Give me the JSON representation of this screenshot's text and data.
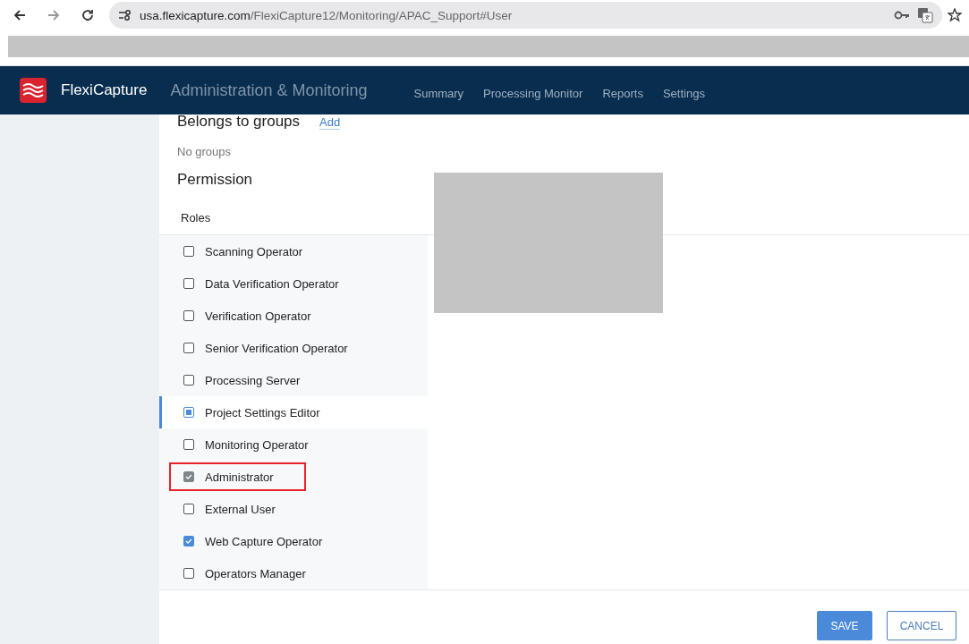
{
  "browser": {
    "url_host": "usa.flexicapture.com",
    "url_path": "/FlexiCapture12/Monitoring/APAC_Support#User"
  },
  "app_header": {
    "brand": "FlexiCapture",
    "section": "Administration & Monitoring",
    "nav": [
      {
        "label": "Summary",
        "selected": false
      },
      {
        "label": "Processing Monitor",
        "selected": false
      },
      {
        "label": "Reports",
        "selected": false
      },
      {
        "label": "Settings",
        "selected": false
      }
    ]
  },
  "groups": {
    "title": "Belongs to groups",
    "add_link": "Add",
    "empty_text": "No groups"
  },
  "permission": {
    "title": "Permission",
    "roles_header": "Roles",
    "roles": [
      {
        "label": "Scanning Operator",
        "kind": "checkbox",
        "checked": false,
        "disabled": false,
        "selected": false,
        "highlighted": false
      },
      {
        "label": "Data Verification Operator",
        "kind": "checkbox",
        "checked": false,
        "disabled": false,
        "selected": false,
        "highlighted": false
      },
      {
        "label": "Verification Operator",
        "kind": "checkbox",
        "checked": false,
        "disabled": false,
        "selected": false,
        "highlighted": false
      },
      {
        "label": "Senior Verification Operator",
        "kind": "checkbox",
        "checked": false,
        "disabled": false,
        "selected": false,
        "highlighted": false
      },
      {
        "label": "Processing Server",
        "kind": "checkbox",
        "checked": false,
        "disabled": false,
        "selected": false,
        "highlighted": false
      },
      {
        "label": "Project Settings Editor",
        "kind": "partial",
        "checked": false,
        "disabled": false,
        "selected": true,
        "highlighted": false
      },
      {
        "label": "Monitoring Operator",
        "kind": "checkbox",
        "checked": false,
        "disabled": false,
        "selected": false,
        "highlighted": false
      },
      {
        "label": "Administrator",
        "kind": "checkbox",
        "checked": true,
        "disabled": true,
        "selected": false,
        "highlighted": true
      },
      {
        "label": "External User",
        "kind": "checkbox",
        "checked": false,
        "disabled": false,
        "selected": false,
        "highlighted": false
      },
      {
        "label": "Web Capture Operator",
        "kind": "checkbox",
        "checked": true,
        "disabled": false,
        "selected": false,
        "highlighted": false
      },
      {
        "label": "Operators Manager",
        "kind": "checkbox",
        "checked": false,
        "disabled": false,
        "selected": false,
        "highlighted": false
      }
    ]
  },
  "buttons": [
    {
      "label": "SAVE",
      "kind": "primary"
    },
    {
      "label": "CANCEL",
      "kind": "secondary"
    }
  ]
}
